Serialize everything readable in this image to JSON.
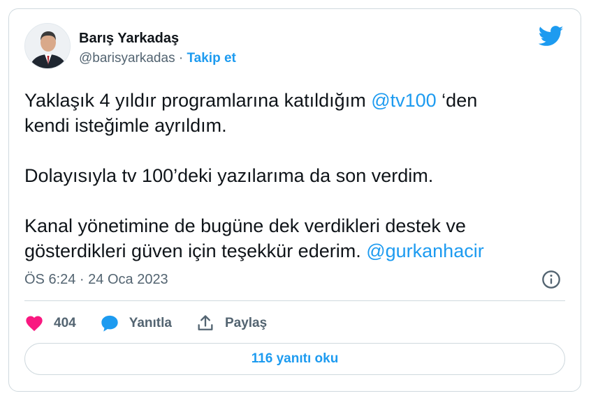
{
  "author": {
    "name": "Barış Yarkadaş",
    "handle": "@barisyarkadas",
    "separator": "·",
    "follow_label": "Takip et"
  },
  "icons": {
    "brand": "twitter-bird-icon",
    "info": "info-icon",
    "like": "heart-icon",
    "reply": "speech-bubble-icon",
    "share": "share-upload-icon"
  },
  "colors": {
    "accent": "#1d9bf0",
    "like": "#f91880",
    "muted_text": "#536471",
    "border": "#cfd9de"
  },
  "tweet": {
    "line1_prefix": "Yaklaşık 4 yıldır programlarına katıldığım ",
    "line1_mention": "@tv100",
    "line1_suffix": " ‘den",
    "line2": "kendi isteğimle ayrıldım.",
    "para2": "Dolayısıyla tv 100’deki yazılarıma da son verdim.",
    "para3_line1": "Kanal yönetimine de bugüne dek verdikleri destek ve",
    "para3_line2_prefix": "gösterdikleri güven için teşekkür ederim. ",
    "para3_mention": "@gurkanhacir"
  },
  "timestamp": "ÖS 6:24 · 24 Oca 2023",
  "actions": {
    "like_count": "404",
    "reply_label": "Yanıtla",
    "share_label": "Paylaş"
  },
  "read_replies_label": "116 yanıtı oku"
}
